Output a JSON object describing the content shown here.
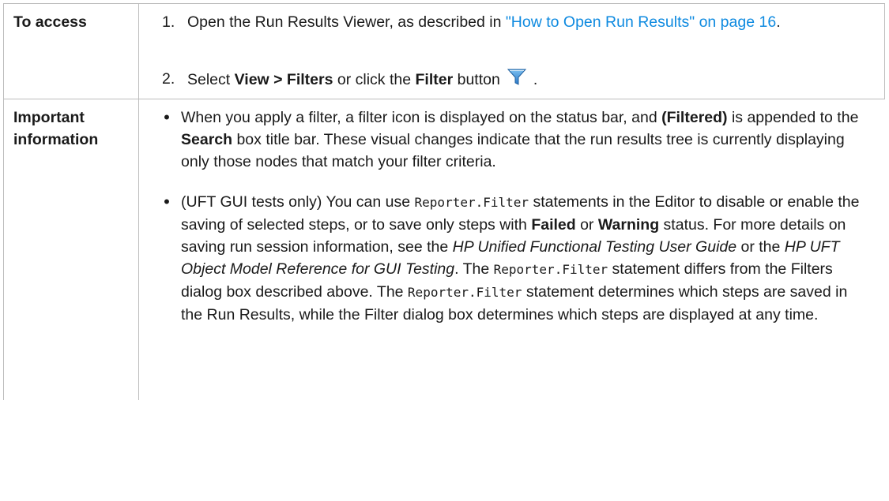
{
  "rows": {
    "access": {
      "label": "To access",
      "step1": {
        "num": "1.",
        "pre": "Open the Run Results Viewer, as described in ",
        "link": "\"How to Open Run Results\" on page 16",
        "post": "."
      },
      "step2": {
        "num": "2.",
        "t1": "Select ",
        "b1": "View > Filters",
        "t2": " or click the ",
        "b2": "Filter",
        "t3": " button",
        "t4": "."
      }
    },
    "important": {
      "label_line1": "Important",
      "label_line2": "information",
      "bullet1": {
        "t1": "When you apply a filter, a filter icon is displayed on the status bar, and ",
        "b1": "(Filtered)",
        "t2": " is appended to the ",
        "b2": "Search",
        "t3": " box title bar. These visual changes indicate that the run results tree is currently displaying only those nodes that match your filter criteria."
      },
      "bullet2": {
        "t1": "(UFT GUI tests only) You can use ",
        "c1": "Reporter.Filter",
        "t2": " statements in the Editor to disable or enable the saving of selected steps, or to save only steps with ",
        "b1": "Failed",
        "t3": " or ",
        "b2": "Warning",
        "t4": " status. For more details on saving run session information, see the ",
        "i1": "HP Unified Functional Testing User Guide",
        "t5": " or the ",
        "i2": "HP UFT Object Model Reference for GUI Testing",
        "t6": ". The ",
        "c2": "Reporter.Filter",
        "t7": " statement differs from the Filters dialog box described above. The ",
        "c3": "Reporter.Filter",
        "t8": " statement determines which steps are saved in the Run Results, while the Filter dialog box determines which steps are displayed at any time."
      }
    }
  },
  "icons": {
    "filter": "filter-funnel-icon",
    "bullet": "bullet-dot-icon"
  },
  "colors": {
    "link": "#0e8ae0",
    "border": "#bcbcbc",
    "filter_icon": "#3a8ed6"
  }
}
